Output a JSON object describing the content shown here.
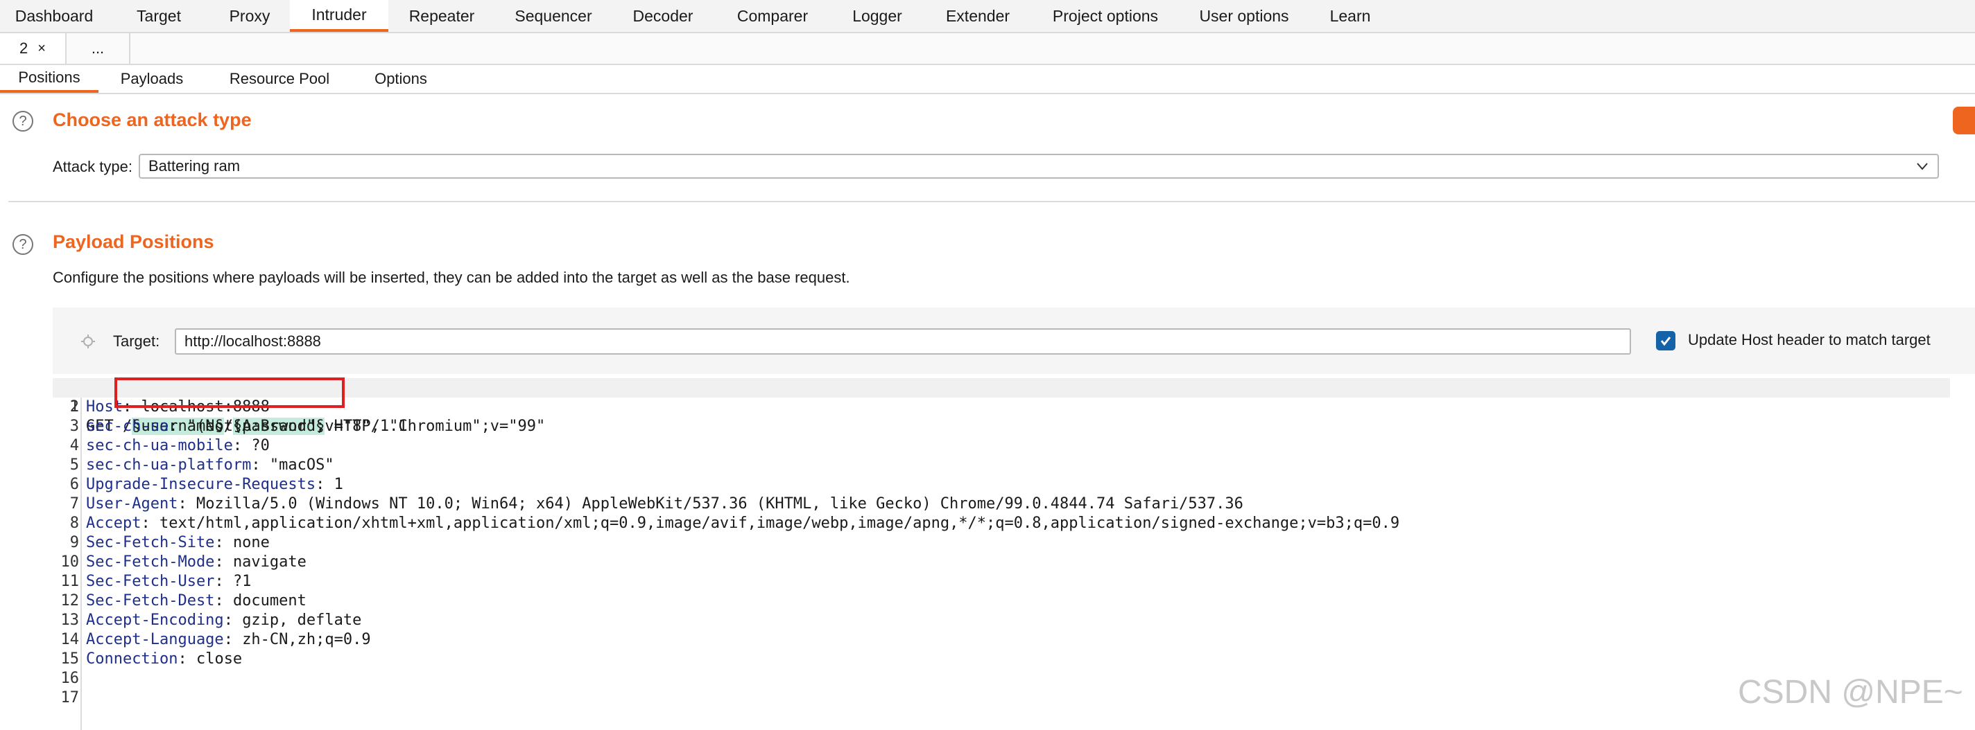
{
  "main_tabs": [
    {
      "label": "Dashboard",
      "active": false
    },
    {
      "label": "Target",
      "active": false
    },
    {
      "label": "Proxy",
      "active": false
    },
    {
      "label": "Intruder",
      "active": true
    },
    {
      "label": "Repeater",
      "active": false
    },
    {
      "label": "Sequencer",
      "active": false
    },
    {
      "label": "Decoder",
      "active": false
    },
    {
      "label": "Comparer",
      "active": false
    },
    {
      "label": "Logger",
      "active": false
    },
    {
      "label": "Extender",
      "active": false
    },
    {
      "label": "Project options",
      "active": false
    },
    {
      "label": "User options",
      "active": false
    },
    {
      "label": "Learn",
      "active": false
    }
  ],
  "request_tabs": {
    "current": "2",
    "close": "×",
    "more": "..."
  },
  "sub_tabs": [
    {
      "label": "Positions",
      "active": true
    },
    {
      "label": "Payloads",
      "active": false
    },
    {
      "label": "Resource Pool",
      "active": false
    },
    {
      "label": "Options",
      "active": false
    }
  ],
  "attack_type_section": {
    "help": "?",
    "title": "Choose an attack type",
    "label": "Attack type:",
    "value": "Battering ram"
  },
  "positions_section": {
    "help": "?",
    "title": "Payload Positions",
    "description": "Configure the positions where payloads will be inserted, they can be added into the target as well as the base request.",
    "target_label": "Target:",
    "target_value": "http://localhost:8888",
    "update_host_label": "Update Host header to match target",
    "update_host_checked": true
  },
  "request_lines": [
    {
      "num": "1",
      "text": "GET /§username§/§password§ HTTP/1.1"
    },
    {
      "num": "2",
      "key": "Host",
      "value": "localhost:8888"
    },
    {
      "num": "3",
      "key": "sec-ch-ua",
      "value": "\"(Not(A:Brand\";v=\"8\", \"Chromium\";v=\"99\""
    },
    {
      "num": "4",
      "key": "sec-ch-ua-mobile",
      "value": "?0"
    },
    {
      "num": "5",
      "key": "sec-ch-ua-platform",
      "value": "\"macOS\""
    },
    {
      "num": "6",
      "key": "Upgrade-Insecure-Requests",
      "value": "1"
    },
    {
      "num": "7",
      "key": "User-Agent",
      "value": "Mozilla/5.0 (Windows NT 10.0; Win64; x64) AppleWebKit/537.36 (KHTML, like Gecko) Chrome/99.0.4844.74 Safari/537.36"
    },
    {
      "num": "8",
      "key": "Accept",
      "value": "text/html,application/xhtml+xml,application/xml;q=0.9,image/avif,image/webp,image/apng,*/*;q=0.8,application/signed-exchange;v=b3;q=0.9"
    },
    {
      "num": "9",
      "key": "Sec-Fetch-Site",
      "value": "none"
    },
    {
      "num": "10",
      "key": "Sec-Fetch-Mode",
      "value": "navigate"
    },
    {
      "num": "11",
      "key": "Sec-Fetch-User",
      "value": "?1"
    },
    {
      "num": "12",
      "key": "Sec-Fetch-Dest",
      "value": "document"
    },
    {
      "num": "13",
      "key": "Accept-Encoding",
      "value": "gzip, deflate"
    },
    {
      "num": "14",
      "key": "Accept-Language",
      "value": "zh-CN,zh;q=0.9"
    },
    {
      "num": "15",
      "key": "Connection",
      "value": "close"
    },
    {
      "num": "16",
      "key": "",
      "value": ""
    },
    {
      "num": "17",
      "key": "",
      "value": ""
    }
  ],
  "request_line_parts": {
    "method": "GET ",
    "slash1": "/",
    "payload1": "§username§",
    "slash2": "/",
    "payload2": "§password§",
    "protocol": " HTTP/1.1"
  },
  "watermark": "CSDN @NPE~",
  "colors": {
    "accent": "#ee6520",
    "header_key": "#1d2f8a",
    "payload_highlight": "#c4ecdc",
    "checkbox": "#1462a8",
    "annotation_box": "#e02020"
  }
}
